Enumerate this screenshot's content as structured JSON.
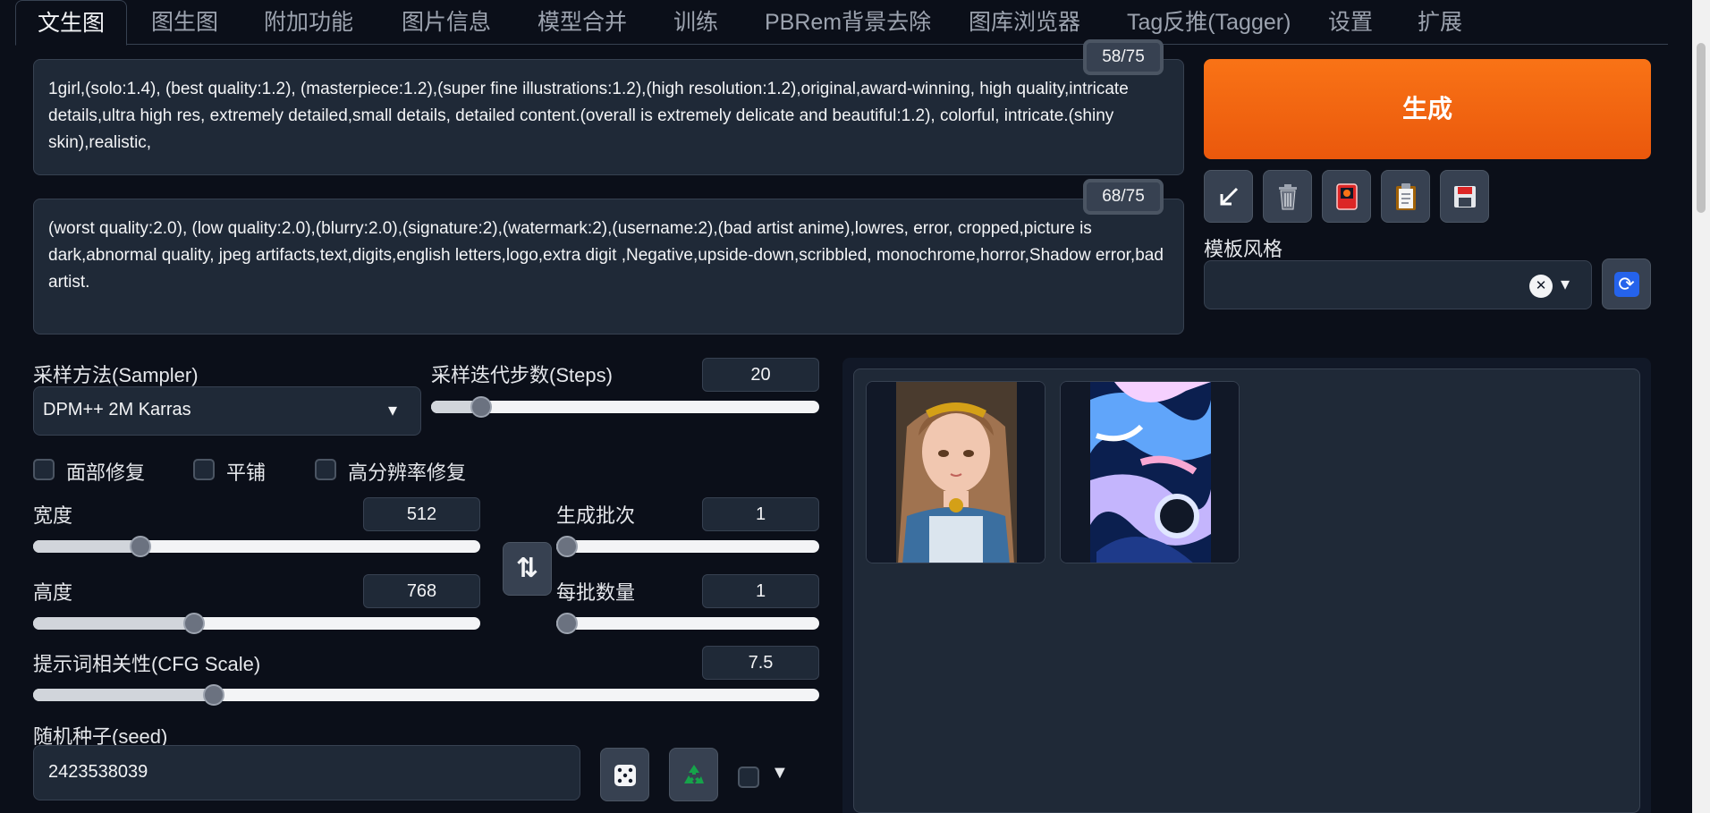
{
  "tabs": [
    {
      "label": "文生图",
      "active": true
    },
    {
      "label": "图生图"
    },
    {
      "label": "附加功能"
    },
    {
      "label": "图片信息"
    },
    {
      "label": "模型合并"
    },
    {
      "label": "训练"
    },
    {
      "label": "PBRem背景去除"
    },
    {
      "label": "图库浏览器"
    },
    {
      "label": "Tag反推(Tagger)"
    },
    {
      "label": "设置"
    },
    {
      "label": "扩展"
    }
  ],
  "prompt": {
    "text": "1girl,(solo:1.4), (best quality:1.2), (masterpiece:1.2),(super fine illustrations:1.2),(high resolution:1.2),original,award-winning, high quality,intricate details,ultra high res, extremely detailed,small details, detailed content.(overall  is extremely delicate and beautiful:1.2), colorful, intricate.(shiny skin),realistic,",
    "counter": "58/75"
  },
  "negative_prompt": {
    "text": "(worst quality:2.0), (low quality:2.0),(blurry:2.0),(signature:2),(watermark:2),(username:2),(bad artist anime),lowres, error, cropped,picture is dark,abnormal quality, jpeg artifacts,text,digits,english letters,logo,extra digit ,Negative,upside-down,scribbled, monochrome,horror,Shadow error,bad artist.",
    "counter": "68/75"
  },
  "generate_label": "生成",
  "tool_icons": [
    "arrow-icon",
    "trash-icon",
    "card-icon",
    "clipboard-icon",
    "save-icon"
  ],
  "styles": {
    "label": "模板风格",
    "clear_glyph": "✕",
    "dropdown_glyph": "▾",
    "refresh_glyph": "⟳"
  },
  "sampler": {
    "label": "采样方法(Sampler)",
    "value": "DPM++ 2M Karras"
  },
  "steps": {
    "label": "采样迭代步数(Steps)",
    "value": "20",
    "fraction": 0.13
  },
  "checkboxes": [
    "面部修复",
    "平铺",
    "高分辨率修复"
  ],
  "width": {
    "label": "宽度",
    "value": "512",
    "fraction": 0.24
  },
  "height": {
    "label": "高度",
    "value": "768",
    "fraction": 0.36
  },
  "batch_count": {
    "label": "生成批次",
    "value": "1",
    "fraction": 0.0
  },
  "batch_size": {
    "label": "每批数量",
    "value": "1",
    "fraction": 0.0
  },
  "swap_glyph": "⇅",
  "cfg": {
    "label": "提示词相关性(CFG Scale)",
    "value": "7.5",
    "fraction": 0.23
  },
  "seed": {
    "label": "随机种子(seed)",
    "value": "2423538039"
  },
  "extra_glyph": "▼",
  "colors": {
    "accent": "#ea580c",
    "bg": "#0b0f19",
    "panel": "#1f2937"
  }
}
